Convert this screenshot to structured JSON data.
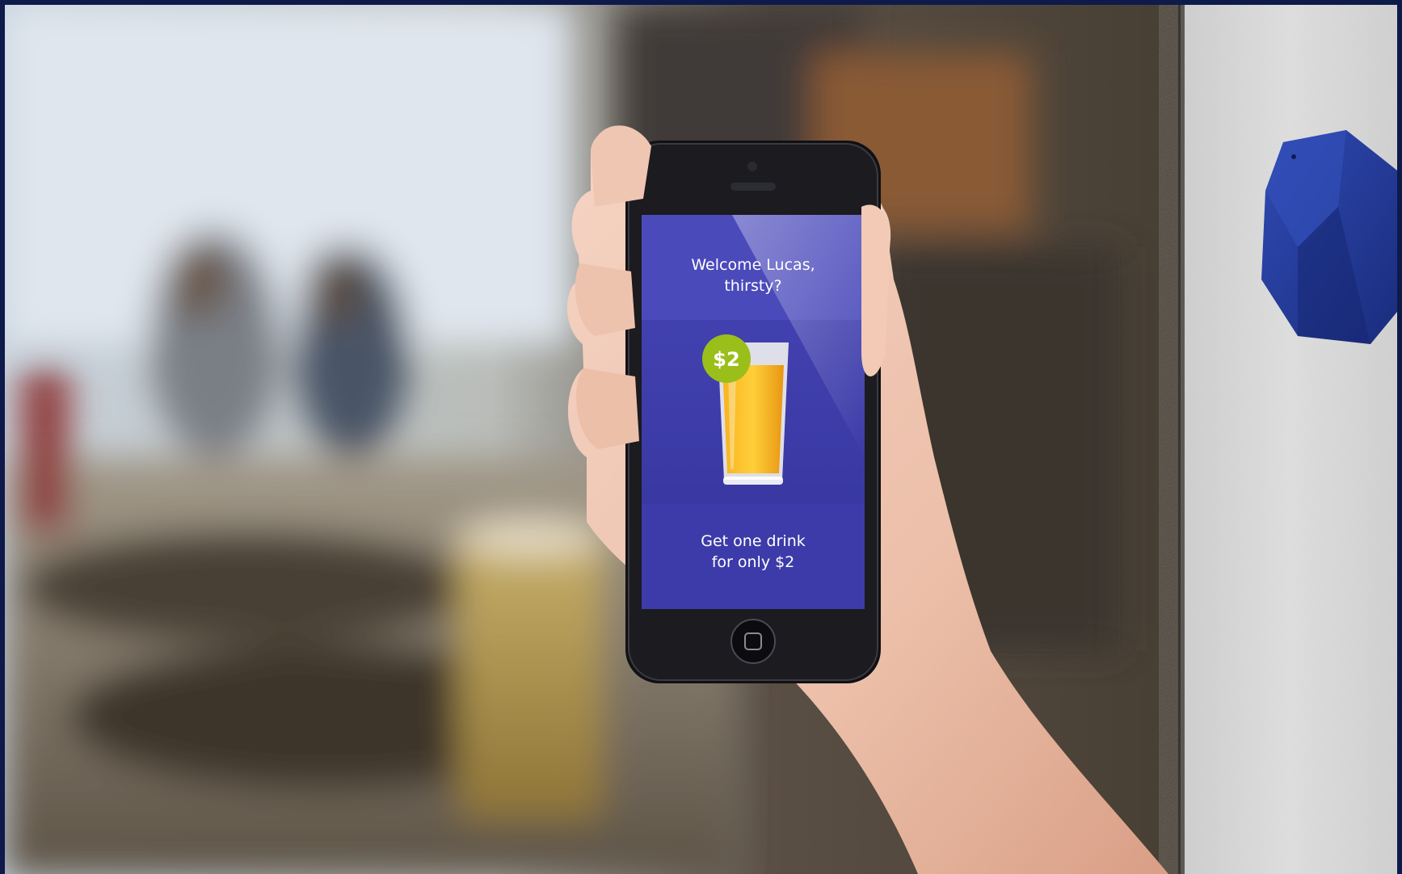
{
  "scene": {
    "description_subjects": [
      "blurred-cafe-background",
      "hand-holding-smartphone",
      "wall-mounted-beacon"
    ]
  },
  "phone_screen": {
    "greeting_line1": "Welcome Lucas,",
    "greeting_line2": "thirsty?",
    "price_badge": "$2",
    "offer_line1": "Get one drink",
    "offer_line2": "for only $2"
  },
  "colors": {
    "screen_blue": "#3b3aa7",
    "screen_header_blue": "#4a49b8",
    "beacon_blue": "#243a9a",
    "badge_green": "#9bbf1a",
    "drink_orange": "#f4a51c",
    "frame_navy": "#0d1a4a"
  },
  "icons": {
    "price_badge": "price-badge-icon",
    "drink": "juice-glass-icon",
    "home_button": "home-button-icon"
  }
}
